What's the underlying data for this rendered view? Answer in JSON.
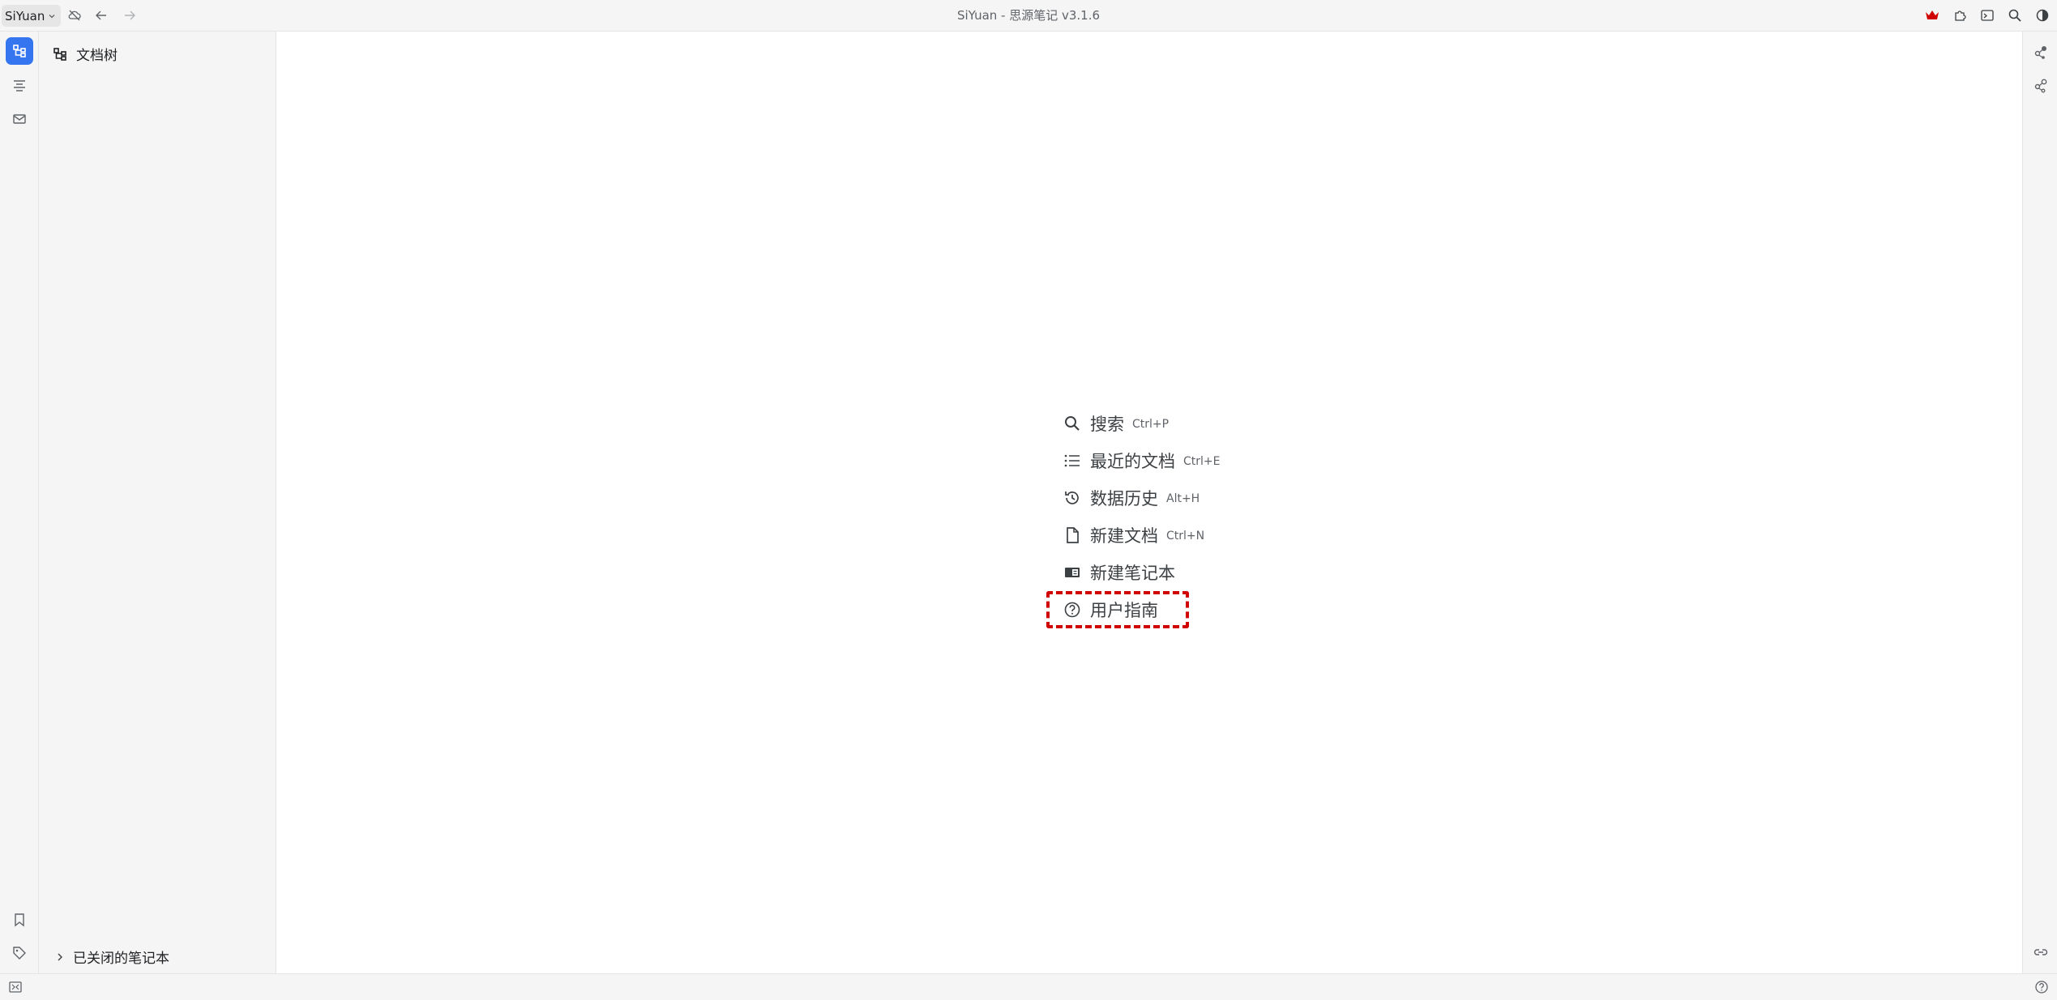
{
  "topbar": {
    "workspace_label": "SiYuan",
    "title": "SiYuan - 思源笔记 v3.1.6",
    "icons": [
      "cloud-off-icon",
      "back-arrow-icon",
      "forward-arrow-icon",
      "crown-icon",
      "plugin-icon",
      "terminal-icon",
      "search-icon",
      "theme-contrast-icon"
    ],
    "accent_color": "#d10000"
  },
  "left_dock": {
    "items": [
      "file-tree-icon",
      "outline-icon",
      "inbox-icon",
      "bookmark-icon",
      "tag-icon"
    ],
    "active_color": "#3575f0"
  },
  "filetree": {
    "title": "文档树",
    "closed_notebooks_label": "已关闭的笔记本"
  },
  "start_menu": {
    "items": [
      {
        "label": "搜索",
        "shortcut": "Ctrl+P",
        "icon": "search-icon"
      },
      {
        "label": "最近的文档",
        "shortcut": "Ctrl+E",
        "icon": "list-icon"
      },
      {
        "label": "数据历史",
        "shortcut": "Alt+H",
        "icon": "history-icon"
      },
      {
        "label": "新建文档",
        "shortcut": "Ctrl+N",
        "icon": "file-icon"
      },
      {
        "label": "新建笔记本",
        "shortcut": "",
        "icon": "notebook-icon"
      },
      {
        "label": "用户指南",
        "shortcut": "",
        "icon": "help-circle-icon"
      }
    ],
    "highlight_color": "#d10000"
  },
  "right_dock": {
    "items": [
      "graph-icon",
      "global-graph-icon",
      "backlink-icon"
    ]
  },
  "statusbar": {
    "items": [
      "dock-toggle-icon",
      "help-icon"
    ]
  }
}
